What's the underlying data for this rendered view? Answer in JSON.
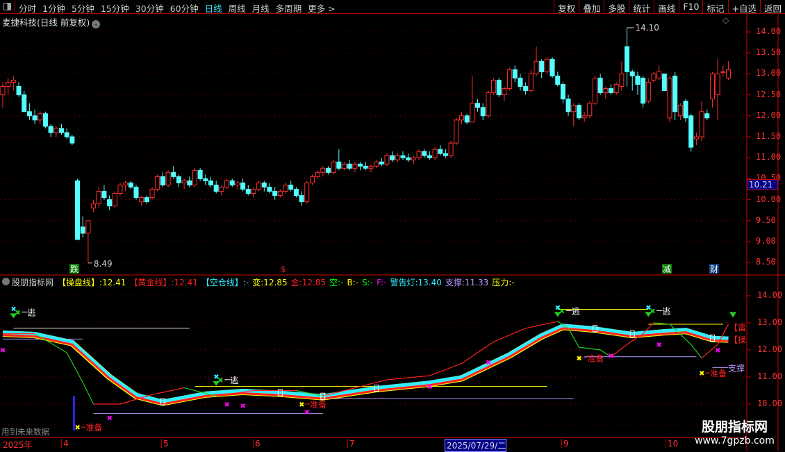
{
  "toolbar": {
    "periods": [
      "分时",
      "1分钟",
      "5分钟",
      "15分钟",
      "30分钟",
      "60分钟",
      "日线",
      "周线",
      "月线",
      "多周期",
      "更多 >"
    ],
    "active": "日线",
    "buttons": [
      "复权",
      "叠加",
      "多股",
      "统计",
      "画线",
      "F10",
      "标记",
      "+自选",
      "返回"
    ]
  },
  "title": "麦捷科技(日线 前复权)",
  "main_axis": [
    "14.00",
    "13.50",
    "13.00",
    "12.50",
    "12.00",
    "11.50",
    "11.00",
    "10.50",
    "10.00",
    "9.50",
    "9.00",
    "8.50"
  ],
  "current_price": "10.21",
  "high_label": "14.10",
  "low_label": "8.49",
  "signals": {
    "die": "跌",
    "dollar": "$",
    "jian": "减",
    "cai": "财"
  },
  "indicator": {
    "name": "股朋指标网",
    "items": [
      {
        "t": "【操盘线】",
        "v": ":12.41",
        "c": "#ff0"
      },
      {
        "t": "【黄金线】",
        "v": ":12.41",
        "c": "#f22"
      },
      {
        "t": "【空仓线】",
        "v": ":-",
        "c": "#3ef"
      },
      {
        "t": "变",
        "v": ":12.85",
        "c": "#ff0"
      },
      {
        "t": "金",
        "v": ":12.85",
        "c": "#f22"
      },
      {
        "t": "空",
        "v": ":-",
        "c": "#0f0"
      },
      {
        "t": "B",
        "v": ":-",
        "c": "#ff0"
      },
      {
        "t": "S",
        "v": ":-",
        "c": "#0f0"
      },
      {
        "t": "F",
        "v": ":-",
        "c": "#f0f"
      },
      {
        "t": "警告灯",
        "v": ":13.40",
        "c": "#3ef"
      },
      {
        "t": "支撑",
        "v": ":11.33",
        "c": "#b9f"
      },
      {
        "t": "压力",
        "v": ":-",
        "c": "#ff0"
      }
    ]
  },
  "lower_axis": [
    "14.00",
    "13.00",
    "12.00",
    "11.00",
    "10.00"
  ],
  "labels": {
    "escape": "逃",
    "ready": "准备",
    "lei": "【雷",
    "cao": "【操",
    "support": "支撑"
  },
  "future_note": "用到未来数据",
  "time_axis": {
    "year": "2025年",
    "months": [
      "4",
      "5",
      "6",
      "7",
      "9",
      "10"
    ],
    "cursor_date": "2025/07/29/二"
  },
  "watermark": {
    "name": "股朋指标网",
    "url": "www.7gpzb.com"
  },
  "colors": {
    "up": "#ff3030",
    "down": "#54ffff",
    "grid": "#8b0000"
  },
  "chart_data": {
    "type": "candlestick",
    "ylim": [
      8.3,
      14.3
    ],
    "ohlc": [
      [
        12.5,
        12.8,
        12.2,
        12.7
      ],
      [
        12.7,
        12.9,
        12.5,
        12.8
      ],
      [
        12.8,
        12.95,
        12.6,
        12.85
      ],
      [
        12.7,
        12.8,
        12.45,
        12.5
      ],
      [
        12.5,
        12.6,
        12.1,
        12.1
      ],
      [
        12.1,
        12.3,
        11.9,
        12.0
      ],
      [
        12.0,
        12.15,
        11.8,
        11.9
      ],
      [
        11.9,
        12.1,
        11.8,
        12.05
      ],
      [
        12.05,
        12.1,
        11.7,
        11.75
      ],
      [
        11.75,
        11.8,
        11.5,
        11.6
      ],
      [
        11.6,
        11.75,
        11.5,
        11.7
      ],
      [
        11.7,
        11.8,
        11.55,
        11.6
      ],
      [
        11.6,
        11.7,
        11.45,
        11.5
      ],
      [
        11.5,
        11.55,
        11.3,
        11.35
      ],
      [
        10.45,
        10.5,
        9.05,
        9.05
      ],
      [
        9.35,
        9.6,
        9.1,
        9.2
      ],
      [
        9.2,
        9.3,
        8.49,
        9.5
      ],
      [
        9.8,
        10.0,
        9.7,
        9.9
      ],
      [
        9.9,
        10.3,
        9.8,
        10.2
      ],
      [
        10.2,
        10.35,
        10.0,
        10.05
      ],
      [
        10.0,
        10.1,
        9.75,
        9.85
      ],
      [
        9.85,
        10.2,
        9.8,
        10.15
      ],
      [
        10.15,
        10.4,
        10.1,
        10.35
      ],
      [
        10.35,
        10.45,
        10.2,
        10.4
      ],
      [
        10.4,
        10.45,
        10.25,
        10.3
      ],
      [
        10.3,
        10.35,
        10.0,
        10.05
      ],
      [
        9.95,
        10.1,
        9.85,
        10.05
      ],
      [
        10.05,
        10.1,
        9.9,
        9.95
      ],
      [
        10.05,
        10.3,
        10.0,
        10.25
      ],
      [
        10.25,
        10.6,
        10.2,
        10.55
      ],
      [
        10.55,
        10.65,
        10.3,
        10.35
      ],
      [
        10.35,
        10.7,
        10.3,
        10.65
      ],
      [
        10.65,
        10.8,
        10.5,
        10.55
      ],
      [
        10.55,
        10.6,
        10.3,
        10.4
      ],
      [
        10.4,
        10.5,
        10.25,
        10.45
      ],
      [
        10.45,
        10.55,
        10.3,
        10.35
      ],
      [
        10.35,
        10.75,
        10.3,
        10.7
      ],
      [
        10.7,
        10.75,
        10.45,
        10.5
      ],
      [
        10.5,
        10.6,
        10.35,
        10.45
      ],
      [
        10.45,
        10.55,
        10.3,
        10.35
      ],
      [
        10.35,
        10.45,
        10.15,
        10.2
      ],
      [
        10.2,
        10.35,
        10.1,
        10.3
      ],
      [
        10.3,
        10.5,
        10.25,
        10.45
      ],
      [
        10.45,
        10.5,
        10.3,
        10.35
      ],
      [
        10.35,
        10.45,
        10.25,
        10.4
      ],
      [
        10.4,
        10.5,
        10.2,
        10.25
      ],
      [
        10.25,
        10.35,
        10.1,
        10.15
      ],
      [
        10.15,
        10.3,
        10.05,
        10.25
      ],
      [
        10.25,
        10.45,
        10.2,
        10.4
      ],
      [
        10.4,
        10.45,
        10.2,
        10.3
      ],
      [
        10.3,
        10.4,
        10.15,
        10.2
      ],
      [
        10.2,
        10.3,
        10.0,
        10.1
      ],
      [
        10.1,
        10.25,
        10.05,
        10.2
      ],
      [
        10.2,
        10.4,
        10.15,
        10.35
      ],
      [
        10.35,
        10.45,
        10.2,
        10.25
      ],
      [
        10.25,
        10.3,
        10.05,
        10.1
      ],
      [
        10.1,
        10.2,
        9.85,
        9.95
      ],
      [
        9.95,
        10.45,
        9.9,
        10.4
      ],
      [
        10.4,
        10.6,
        10.35,
        10.55
      ],
      [
        10.55,
        10.7,
        10.5,
        10.65
      ],
      [
        10.65,
        10.8,
        10.55,
        10.75
      ],
      [
        10.75,
        10.8,
        10.6,
        10.65
      ],
      [
        10.65,
        10.95,
        10.6,
        10.9
      ],
      [
        10.9,
        11.2,
        10.7,
        10.75
      ],
      [
        10.75,
        10.9,
        10.7,
        10.85
      ],
      [
        10.85,
        10.95,
        10.7,
        10.75
      ],
      [
        10.75,
        10.9,
        10.65,
        10.85
      ],
      [
        10.85,
        10.9,
        10.7,
        10.8
      ],
      [
        10.8,
        10.9,
        10.7,
        10.75
      ],
      [
        10.75,
        10.85,
        10.65,
        10.8
      ],
      [
        10.8,
        10.95,
        10.75,
        10.9
      ],
      [
        10.9,
        11.0,
        10.8,
        10.85
      ],
      [
        10.85,
        11.1,
        10.8,
        11.05
      ],
      [
        11.05,
        11.15,
        10.9,
        10.95
      ],
      [
        10.95,
        11.1,
        10.9,
        11.05
      ],
      [
        11.05,
        11.15,
        10.95,
        11.0
      ],
      [
        11.0,
        11.1,
        10.9,
        10.95
      ],
      [
        10.95,
        11.05,
        10.85,
        11.0
      ],
      [
        11.0,
        11.2,
        10.95,
        11.15
      ],
      [
        11.15,
        11.2,
        11.0,
        11.05
      ],
      [
        11.05,
        11.15,
        10.95,
        11.0
      ],
      [
        11.0,
        11.25,
        10.95,
        11.2
      ],
      [
        11.2,
        11.3,
        11.05,
        11.1
      ],
      [
        11.1,
        11.2,
        11.0,
        11.05
      ],
      [
        11.05,
        11.4,
        11.0,
        11.35
      ],
      [
        11.35,
        11.95,
        11.3,
        11.9
      ],
      [
        11.9,
        12.1,
        11.8,
        12.0
      ],
      [
        12.0,
        12.05,
        11.8,
        11.85
      ],
      [
        11.85,
        12.95,
        11.85,
        12.3
      ],
      [
        12.3,
        12.4,
        12.1,
        12.2
      ],
      [
        12.2,
        12.3,
        11.9,
        12.0
      ],
      [
        12.0,
        12.6,
        11.95,
        12.55
      ],
      [
        12.55,
        12.9,
        12.5,
        12.85
      ],
      [
        12.85,
        12.9,
        12.45,
        12.5
      ],
      [
        12.5,
        12.7,
        12.35,
        12.65
      ],
      [
        12.65,
        13.15,
        12.6,
        13.1
      ],
      [
        13.1,
        13.2,
        12.8,
        12.9
      ],
      [
        12.9,
        13.0,
        12.6,
        12.7
      ],
      [
        12.7,
        12.8,
        12.5,
        12.6
      ],
      [
        12.6,
        13.1,
        12.55,
        13.0
      ],
      [
        13.0,
        13.65,
        12.95,
        13.3
      ],
      [
        13.3,
        13.35,
        12.9,
        13.05
      ],
      [
        13.05,
        13.4,
        13.0,
        13.35
      ],
      [
        13.35,
        13.4,
        12.9,
        12.95
      ],
      [
        12.95,
        13.05,
        12.7,
        12.75
      ],
      [
        12.75,
        12.8,
        12.3,
        12.4
      ],
      [
        12.4,
        12.5,
        12.0,
        12.1
      ],
      [
        12.1,
        12.3,
        11.75,
        12.25
      ],
      [
        12.25,
        12.3,
        11.9,
        11.95
      ],
      [
        11.95,
        12.1,
        11.85,
        12.0
      ],
      [
        12.0,
        12.35,
        11.95,
        12.3
      ],
      [
        12.3,
        12.95,
        12.25,
        12.9
      ],
      [
        12.9,
        13.0,
        12.5,
        12.55
      ],
      [
        12.55,
        12.7,
        12.4,
        12.65
      ],
      [
        12.65,
        12.75,
        12.5,
        12.55
      ],
      [
        12.55,
        12.8,
        12.5,
        12.75
      ],
      [
        12.7,
        13.3,
        12.6,
        13.0
      ],
      [
        13.65,
        14.1,
        12.7,
        13.05
      ],
      [
        13.05,
        13.1,
        12.6,
        12.95
      ],
      [
        12.95,
        13.05,
        12.5,
        12.75
      ],
      [
        12.9,
        12.95,
        12.2,
        12.3
      ],
      [
        12.35,
        12.9,
        12.3,
        12.8
      ],
      [
        12.85,
        13.05,
        12.8,
        13.0
      ],
      [
        12.9,
        13.2,
        12.85,
        13.05
      ],
      [
        13.0,
        13.0,
        12.6,
        12.6
      ],
      [
        11.95,
        12.95,
        11.85,
        12.9
      ],
      [
        12.95,
        13.05,
        11.9,
        12.1
      ],
      [
        12.0,
        12.3,
        11.9,
        12.25
      ],
      [
        12.35,
        12.4,
        11.85,
        11.95
      ],
      [
        12.0,
        12.05,
        11.15,
        11.25
      ],
      [
        11.45,
        11.6,
        11.3,
        11.5
      ],
      [
        11.5,
        12.35,
        11.4,
        12.1
      ],
      [
        12.05,
        12.15,
        11.9,
        11.95
      ],
      [
        12.4,
        13.05,
        12.2,
        13.0
      ],
      [
        12.5,
        13.35,
        11.9,
        13.0
      ],
      [
        13.05,
        13.2,
        12.95,
        13.05
      ],
      [
        12.9,
        13.3,
        12.85,
        13.1
      ]
    ],
    "indicator_ylim": [
      9.0,
      14.7
    ],
    "main_line": [
      [
        0,
        12.6
      ],
      [
        6,
        12.55
      ],
      [
        13,
        12.25
      ],
      [
        20,
        11.0
      ],
      [
        25,
        10.3
      ],
      [
        30,
        10.05
      ],
      [
        38,
        10.35
      ],
      [
        45,
        10.45
      ],
      [
        52,
        10.38
      ],
      [
        60,
        10.25
      ],
      [
        70,
        10.55
      ],
      [
        80,
        10.75
      ],
      [
        86,
        10.95
      ],
      [
        95,
        11.8
      ],
      [
        101,
        12.5
      ],
      [
        105,
        12.85
      ],
      [
        111,
        12.75
      ],
      [
        118,
        12.55
      ],
      [
        124,
        12.65
      ],
      [
        128,
        12.7
      ],
      [
        133,
        12.4
      ],
      [
        136,
        12.38
      ]
    ],
    "fast_line": [
      [
        0,
        12.6
      ],
      [
        6,
        12.6
      ],
      [
        12,
        11.9
      ],
      [
        15,
        10.8
      ],
      [
        17,
        10.0
      ],
      [
        22,
        10.0
      ],
      [
        28,
        10.35
      ],
      [
        34,
        10.6
      ],
      [
        40,
        10.3
      ],
      [
        47,
        10.5
      ],
      [
        55,
        10.5
      ],
      [
        60,
        10.3
      ],
      [
        66,
        10.6
      ],
      [
        72,
        10.9
      ],
      [
        80,
        11.05
      ],
      [
        86,
        11.5
      ],
      [
        92,
        12.3
      ],
      [
        98,
        12.8
      ],
      [
        104,
        13.05
      ],
      [
        106,
        12.8
      ],
      [
        108,
        12.1
      ],
      [
        112,
        12.0
      ],
      [
        114,
        11.75
      ],
      [
        117,
        12.2
      ],
      [
        120,
        12.6
      ],
      [
        122,
        13.0
      ],
      [
        125,
        12.95
      ],
      [
        129,
        12.2
      ],
      [
        131,
        11.7
      ],
      [
        134,
        12.2
      ],
      [
        136,
        12.95
      ]
    ],
    "hlines": [
      [
        2,
        35,
        12.8,
        "#ddd"
      ],
      [
        0,
        15,
        12.4,
        "#99f"
      ],
      [
        104,
        121,
        13.5,
        "#ff0"
      ],
      [
        121,
        135,
        12.95,
        "#ff0"
      ],
      [
        109,
        130,
        11.75,
        "#b9f"
      ],
      [
        133,
        136,
        11.35,
        "#b9f"
      ],
      [
        36,
        102,
        10.65,
        "#ff0"
      ],
      [
        60,
        107,
        10.2,
        "#b9f"
      ],
      [
        17,
        60,
        9.65,
        "#b9f"
      ]
    ],
    "escape_marks": [
      [
        2,
        13.35
      ],
      [
        40,
        10.85
      ],
      [
        104,
        13.4
      ],
      [
        121,
        13.4
      ]
    ],
    "ready_marks": [
      [
        14,
        9.15
      ],
      [
        56,
        10.0
      ],
      [
        108,
        11.7
      ],
      [
        131,
        11.15
      ]
    ],
    "x_marks": [
      [
        0,
        12.0
      ],
      [
        20,
        9.5
      ],
      [
        42,
        10.0
      ],
      [
        45,
        9.95
      ],
      [
        80,
        10.65
      ],
      [
        91,
        11.55
      ],
      [
        114,
        11.8
      ],
      [
        123,
        12.2
      ],
      [
        134,
        12.0
      ],
      [
        57,
        9.72
      ]
    ]
  }
}
